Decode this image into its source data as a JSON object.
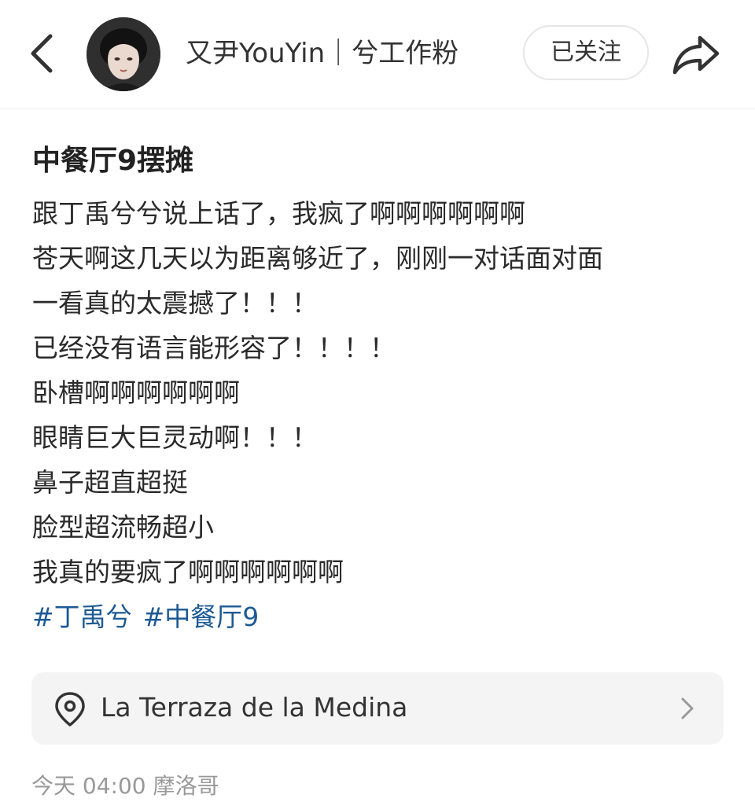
{
  "header": {
    "author_name": "又尹YouYin｜兮工作粉",
    "follow_label": "已关注",
    "back_icon": "chevron-left-icon",
    "share_icon": "share-arrow-icon"
  },
  "post": {
    "title": "中餐厅9摆摊",
    "lines": [
      "跟丁禹兮兮说上话了，我疯了啊啊啊啊啊啊",
      "苍天啊这几天以为距离够近了，刚刚一对话面对面",
      "一看真的太震撼了！！！",
      "已经没有语言能形容了！！！！",
      "卧槽啊啊啊啊啊啊",
      "眼睛巨大巨灵动啊！！！",
      "鼻子超直超挺",
      "脸型超流畅超小",
      "我真的要疯了啊啊啊啊啊啊"
    ],
    "tags": [
      "#丁禹兮",
      "#中餐厅9"
    ]
  },
  "location": {
    "name": "La Terraza de la Medina",
    "icon": "location-pin-icon"
  },
  "footer": {
    "meta": "今天 04:00 摩洛哥"
  },
  "colors": {
    "tag": "#1d5a94",
    "card_bg": "#f4f4f4",
    "divider": "#efefef"
  }
}
